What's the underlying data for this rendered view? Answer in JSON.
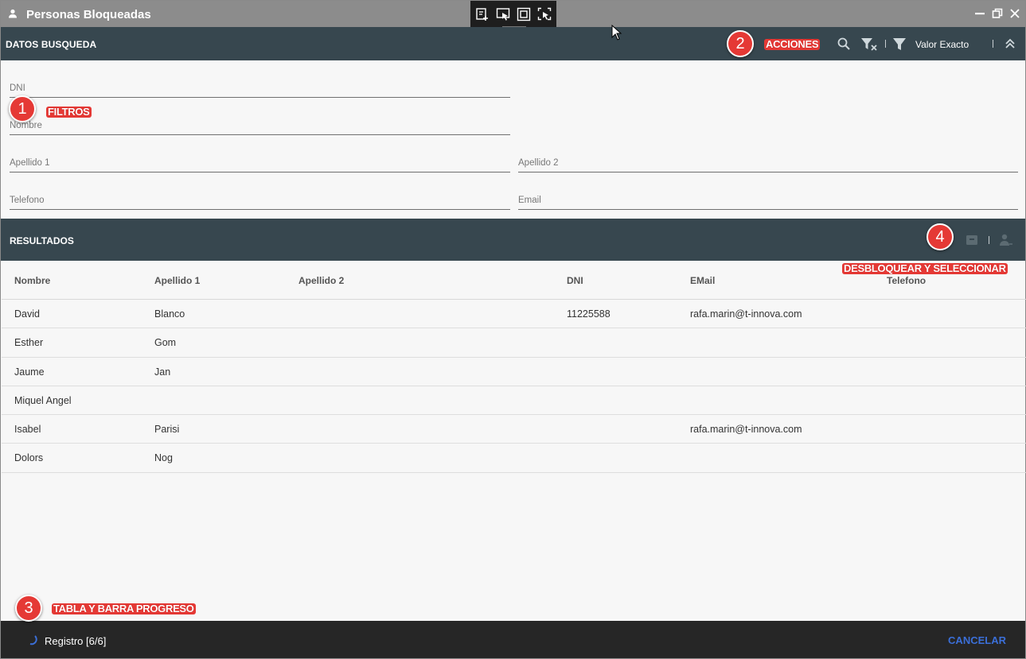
{
  "window": {
    "title": "Personas Bloqueadas"
  },
  "search": {
    "header_title": "DATOS BUSQUEDA",
    "exact_label": "Valor Exacto",
    "fields": {
      "dni": "DNI",
      "nombre": "Nombre",
      "apellido1": "Apellido 1",
      "apellido2": "Apellido 2",
      "telefono": "Telefono",
      "email": "Email"
    }
  },
  "results": {
    "header_title": "RESULTADOS",
    "columns": [
      "Nombre",
      "Apellido 1",
      "Apellido 2",
      "DNI",
      "EMail",
      "Telefono"
    ],
    "rows": [
      [
        "David",
        "Blanco",
        "",
        "11225588",
        "rafa.marin@t-innova.com",
        ""
      ],
      [
        "Esther",
        "Gom",
        "",
        "",
        "",
        ""
      ],
      [
        "Jaume",
        "Jan",
        "",
        "",
        "",
        ""
      ],
      [
        "Miquel Angel",
        "",
        "",
        "",
        "",
        ""
      ],
      [
        "Isabel",
        "Parisi",
        "",
        "",
        "rafa.marin@t-innova.com",
        ""
      ],
      [
        "Dolors",
        "Nog",
        "",
        "",
        "",
        ""
      ]
    ]
  },
  "annotations": [
    {
      "number": "1",
      "text": "FILTROS"
    },
    {
      "number": "2",
      "text": "ACCIONES"
    },
    {
      "number": "3",
      "text": "TABLA Y BARRA PROGRESO"
    },
    {
      "number": "4",
      "text": "DESBLOQUEAR Y SELECCIONAR"
    }
  ],
  "footer": {
    "status": "Registro [6/6]",
    "cancel_label": "CANCELAR"
  },
  "icons": {
    "title": "person-icon",
    "search": "search-icon",
    "clear_filter": "filter-clear-icon",
    "filter": "filter-icon",
    "collapse": "chevron-double-up-icon",
    "unlock": "archive-icon",
    "select": "person-select-icon",
    "spinner": "spinner-icon"
  },
  "colors": {
    "header_bg": "#37474f",
    "title_bg": "#8c8c8c",
    "footer_bg": "#262626",
    "accent": "#3b6fd8",
    "annotation": "#e53935"
  }
}
